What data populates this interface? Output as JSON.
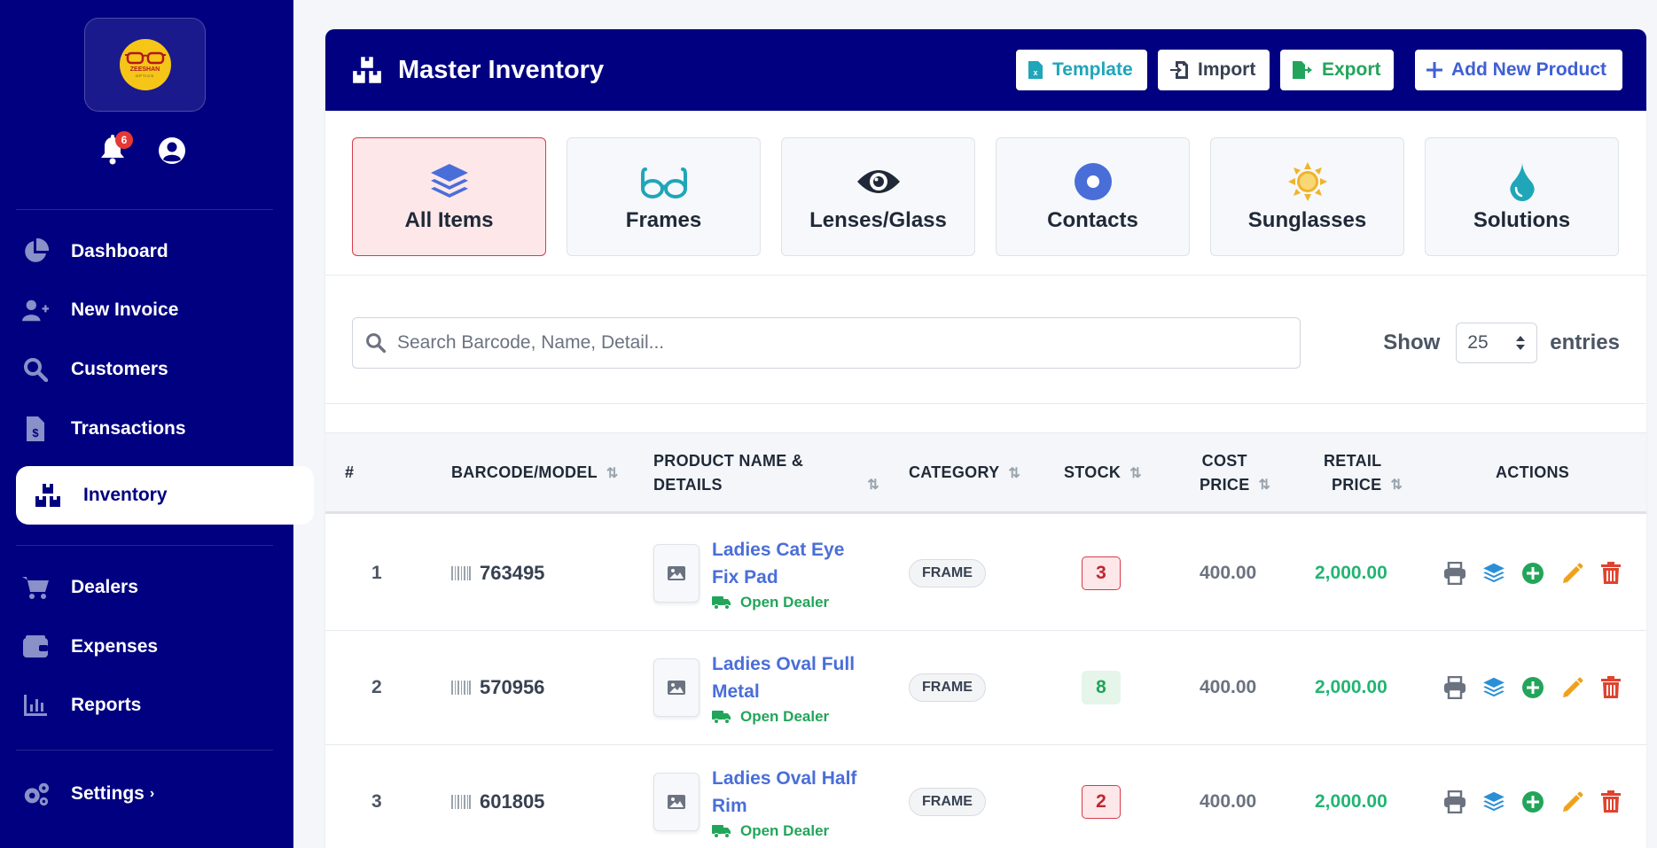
{
  "app": {
    "logo_brand": "ZEESHAN",
    "logo_sub": "OPTICS",
    "notification_count": "6"
  },
  "sidebar": {
    "items": [
      {
        "label": "Dashboard",
        "icon": "pie-chart-icon"
      },
      {
        "label": "New Invoice",
        "icon": "user-plus-icon"
      },
      {
        "label": "Customers",
        "icon": "search-icon"
      },
      {
        "label": "Transactions",
        "icon": "file-invoice-dollar-icon"
      },
      {
        "label": "Inventory",
        "icon": "boxes-icon",
        "active": true
      },
      {
        "label": "Dealers",
        "icon": "cart-icon"
      },
      {
        "label": "Expenses",
        "icon": "wallet-icon"
      },
      {
        "label": "Reports",
        "icon": "bar-chart-icon"
      },
      {
        "label": "Settings",
        "icon": "gears-icon"
      }
    ]
  },
  "header": {
    "title": "Master Inventory",
    "buttons": {
      "template": "Template",
      "import": "Import",
      "export": "Export",
      "add": "Add New Product"
    }
  },
  "categories": [
    {
      "label": "All Items",
      "icon": "layers-icon",
      "active": true
    },
    {
      "label": "Frames",
      "icon": "glasses-icon"
    },
    {
      "label": "Lenses/Glass",
      "icon": "eye-icon"
    },
    {
      "label": "Contacts",
      "icon": "dot-circle-icon"
    },
    {
      "label": "Sunglasses",
      "icon": "sun-icon"
    },
    {
      "label": "Solutions",
      "icon": "droplet-icon"
    }
  ],
  "search": {
    "placeholder": "Search Barcode, Name, Detail...",
    "value": ""
  },
  "entries": {
    "show_label": "Show",
    "value": "25",
    "suffix": "entries"
  },
  "table": {
    "headers": {
      "num": "#",
      "barcode": "BARCODE/MODEL",
      "product_l1": "PRODUCT NAME &",
      "product_l2": "DETAILS",
      "category": "CATEGORY",
      "stock": "STOCK",
      "cost_l1": "COST",
      "cost_l2": "PRICE",
      "retail_l1": "RETAIL",
      "retail_l2": "PRICE",
      "actions": "ACTIONS"
    },
    "rows": [
      {
        "num": "1",
        "barcode": "763495",
        "name_l1": "Ladies Cat Eye",
        "name_l2": "Fix Pad",
        "dealer": "Open Dealer",
        "category": "FRAME",
        "stock": "3",
        "stock_level": "low",
        "cost": "400.00",
        "retail": "2,000.00"
      },
      {
        "num": "2",
        "barcode": "570956",
        "name_l1": "Ladies Oval Full",
        "name_l2": "Metal",
        "dealer": "Open Dealer",
        "category": "FRAME",
        "stock": "8",
        "stock_level": "ok",
        "cost": "400.00",
        "retail": "2,000.00"
      },
      {
        "num": "3",
        "barcode": "601805",
        "name_l1": "Ladies Oval Half",
        "name_l2": "Rim",
        "dealer": "Open Dealer",
        "category": "FRAME",
        "stock": "2",
        "stock_level": "low",
        "cost": "400.00",
        "retail": "2,000.00"
      }
    ],
    "row_actions": [
      "print-icon",
      "layers-icon",
      "plus-circle-icon",
      "pencil-icon",
      "trash-icon"
    ]
  },
  "colors": {
    "sidebar_bg": "#000080",
    "accent_blue": "#4a6ed8",
    "success_green": "#22a55a",
    "danger_red": "#d83a4a",
    "retail_green": "#22b573"
  }
}
